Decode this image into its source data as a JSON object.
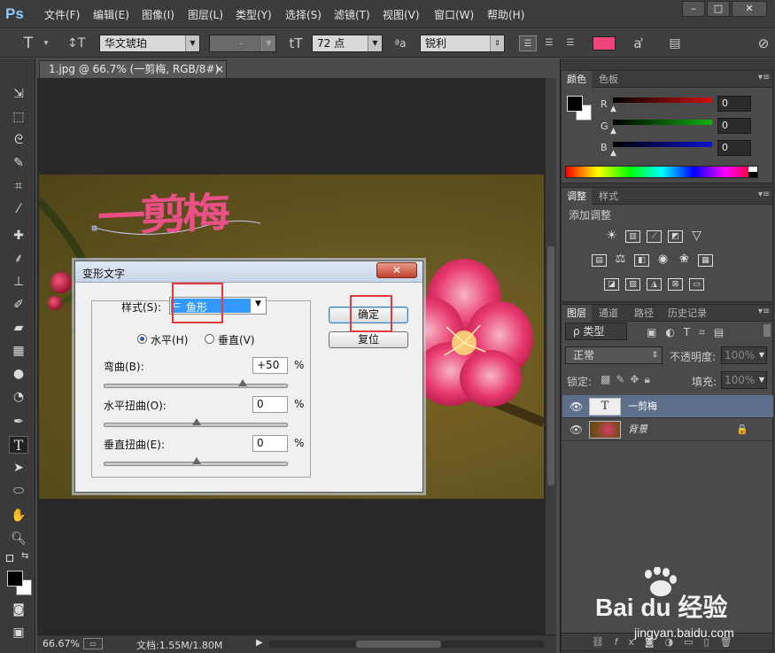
{
  "app": {
    "logo": "Ps",
    "menu": [
      "文件(F)",
      "编辑(E)",
      "图像(I)",
      "图层(L)",
      "类型(Y)",
      "选择(S)",
      "滤镜(T)",
      "视图(V)",
      "窗口(W)",
      "帮助(H)"
    ],
    "window_controls": [
      "–",
      "□",
      "✕"
    ]
  },
  "options_bar": {
    "font_family": "华文琥珀",
    "font_style": "-",
    "font_size": "72 点",
    "antialias_icon": "ªa",
    "antialias": "锐利",
    "text_color": "#f0457a"
  },
  "document": {
    "tab_title": "1.jpg @ 66.7% (一剪梅, RGB/8#) *",
    "tab_close": "×",
    "canvas_text": "一剪梅",
    "canvas_text_color": "#ea4f86",
    "zoom": "66.67%",
    "doc_size": "文档:1.55M/1.80M"
  },
  "warp_dialog": {
    "title": "变形文字",
    "close": "✕",
    "style_label": "样式(S):",
    "style_value": "鱼形",
    "horizontal_label": "水平(H)",
    "vertical_label": "垂直(V)",
    "orientation_selected": "horizontal",
    "bend_label": "弯曲(B):",
    "bend_value": "+50",
    "bend_level": 0.75,
    "hdist_label": "水平扭曲(O):",
    "hdist_value": "0",
    "hdist_level": 0.5,
    "vdist_label": "垂直扭曲(E):",
    "vdist_value": "0",
    "vdist_level": 0.5,
    "percent": "%",
    "ok_label": "确定",
    "reset_label": "复位",
    "highlight_color": "#e23a3a"
  },
  "color_panel": {
    "tabs": [
      "颜色",
      "色板"
    ],
    "r_label": "R",
    "g_label": "G",
    "b_label": "B",
    "r_value": "0",
    "g_value": "0",
    "b_value": "0",
    "r_color": "#d01010",
    "g_color": "#10b010",
    "b_color": "#1010d0"
  },
  "adjust_panel": {
    "tabs": [
      "调整",
      "样式"
    ],
    "title": "添加调整"
  },
  "layers_panel": {
    "tabs": [
      "图层",
      "通道",
      "路径",
      "历史记录"
    ],
    "filter_label": "ρ 类型",
    "blend_mode": "正常",
    "opacity_label": "不透明度:",
    "opacity_value": "100%",
    "lock_label": "锁定:",
    "fill_label": "填充:",
    "fill_value": "100%",
    "layers": [
      {
        "name": "一剪梅",
        "type_icon": "T"
      },
      {
        "name": "背景",
        "type_icon": "image"
      }
    ],
    "lock_icon": "🔒"
  },
  "watermark": {
    "brand": "Bai du 经验",
    "url": "jingyan.baidu.com"
  }
}
